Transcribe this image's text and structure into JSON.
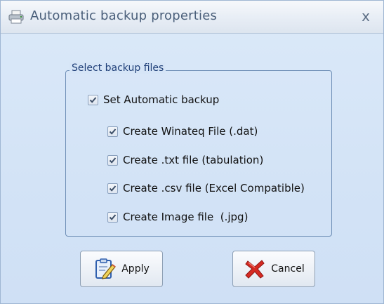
{
  "window": {
    "title": "Automatic backup properties",
    "close_glyph": "x",
    "icon": "printer-icon"
  },
  "groupbox": {
    "legend": "Select backup files"
  },
  "options": {
    "auto_backup": {
      "label": "Set Automatic backup",
      "checked": true
    },
    "items": [
      {
        "label": "Create Winateq File (.dat)",
        "checked": true
      },
      {
        "label": "Create .txt file (tabulation)",
        "checked": true
      },
      {
        "label": "Create .csv file (Excel Compatible)",
        "checked": true
      },
      {
        "label": "Create Image file  (.jpg)",
        "checked": true
      }
    ]
  },
  "buttons": {
    "apply": {
      "label": "Apply",
      "icon": "clipboard-pen-icon"
    },
    "cancel": {
      "label": "Cancel",
      "icon": "red-x-icon"
    }
  },
  "colors": {
    "accent": "#6f8fb7",
    "legend_text": "#1f3f78",
    "check_mark": "#3b4d66",
    "cancel_red": "#d52a22"
  }
}
